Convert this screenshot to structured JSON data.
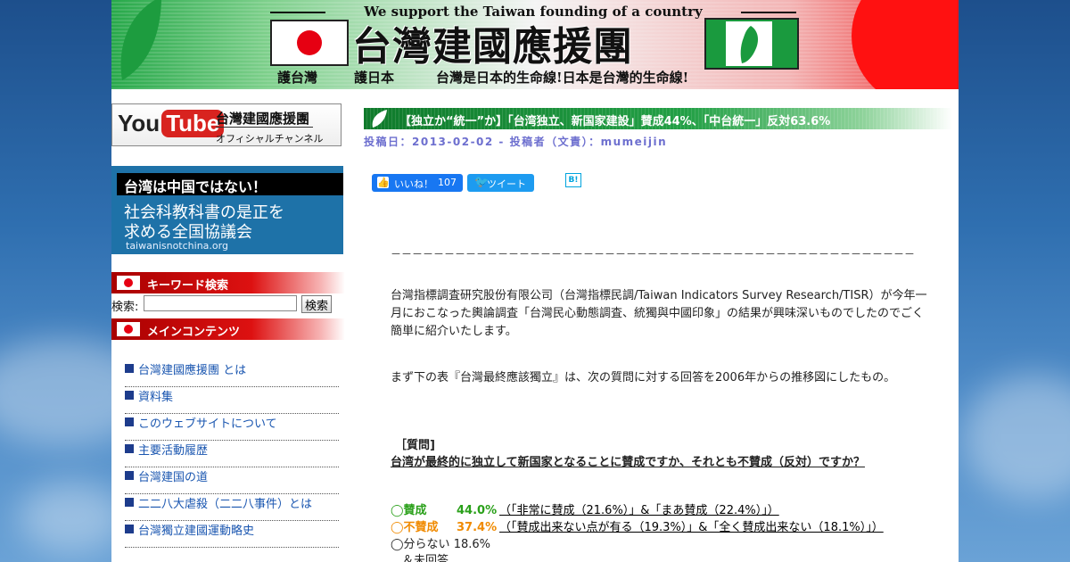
{
  "header": {
    "tagline": "We support the Taiwan founding of a country",
    "site_title": "台灣建國應援團",
    "slogan_1": "護台灣",
    "slogan_2": "護日本",
    "slogan_3": "台灣是日本的生命線!日本是台灣的生命線!"
  },
  "sidebar": {
    "youtube": {
      "logo_you": "You",
      "logo_tube": "Tube",
      "title": "台灣建國應援團",
      "subtitle": "オフィシャルチャンネル"
    },
    "banner": {
      "headline": "台湾は中国ではない！",
      "line1": "社会科教科書の是正を",
      "line2": "求める全国協議会",
      "url": "taiwanisnotchina.org"
    },
    "search_section_title": "キーワード検索",
    "search_label": "検索:",
    "search_value": "",
    "search_button": "検索",
    "menu_section_title": "メインコンテンツ",
    "menu_items": [
      {
        "label": "台灣建國應援團 とは"
      },
      {
        "label": "資料集"
      },
      {
        "label": "このウェブサイトについて"
      },
      {
        "label": "主要活動履歴"
      },
      {
        "label": "台灣建国の道"
      },
      {
        "label": "二二八大虐殺（二二八事件）とは"
      },
      {
        "label": "台灣獨立建國運動略史"
      }
    ]
  },
  "post": {
    "title": "【独立か“統一”か】「台湾独立、新国家建設」賛成44%、「中台統一」反対63.6%",
    "meta": "投稿日：2013-02-02 - 投稿者（文責）：mumeijin",
    "divider": "－－－－－－－－－－－－－－－－－－－－－－－－－－－－－－－－－－－－－－－－－－－－－－－－－",
    "paragraph_1": "台灣指標調査研究股份有限公司（台灣指標民調/Taiwan Indicators Survey Research/TISR）が今年一月におこなった輿論調査「台灣民心動態調査、統獨與中國印象」の結果が興味深いものでしたのでごく簡単に紹介いたします。",
    "paragraph_2": "まず下の表『台灣最終應該獨立』は、次の質問に対する回答を2006年からの推移図にしたもの。",
    "question_heading": "［質問]",
    "question": "台湾が最終的に独立して新国家となることに賛成ですか、それとも不賛成（反対）ですか？",
    "answers": [
      {
        "key": "◯賛成",
        "value": "44.0%",
        "detail": "（「非常に賛成（21.6%）」&「まあ賛成（22.4%）」）"
      },
      {
        "key": "◯不賛成",
        "value": "37.4%",
        "detail": "（「賛成出来ない点が有る（19.3%）」&「全く賛成出来ない（18.1%）」）"
      },
      {
        "key": "◯分らない",
        "value": "18.6%"
      },
      {
        "key": "　＆未回答"
      }
    ]
  },
  "social": {
    "fb_label": "いいね！",
    "fb_count": "107",
    "tweet_label": "ツイート",
    "hatena_label": "B!"
  }
}
